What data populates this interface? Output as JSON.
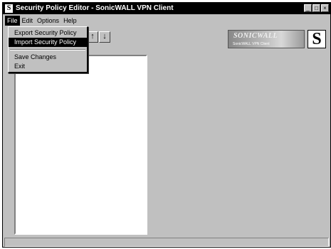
{
  "window": {
    "title": "Security Policy Editor - SonicWALL VPN Client",
    "app_icon_letter": "S",
    "controls": [
      "_",
      "□",
      "×"
    ]
  },
  "menubar": {
    "items": [
      {
        "label": "File",
        "active": true
      },
      {
        "label": "Edit",
        "active": false
      },
      {
        "label": "Options",
        "active": false
      },
      {
        "label": "Help",
        "active": false
      }
    ]
  },
  "file_menu": {
    "items": [
      {
        "label": "Export Security Policy",
        "highlighted": false
      },
      {
        "label": "Import Security Policy",
        "highlighted": true
      },
      {
        "label": "Save Changes",
        "highlighted": false
      },
      {
        "label": "Exit",
        "highlighted": false
      }
    ]
  },
  "toolbar": {
    "up_arrow": "↑",
    "down_arrow": "↓"
  },
  "branding": {
    "logo_text": "SONICWALL",
    "logo_subtitle": "SonicWALL VPN Client",
    "logo_mark": "S"
  },
  "icons": {
    "app": "sonicwall-s-icon",
    "move_up": "arrow-up-icon",
    "move_down": "arrow-down-icon",
    "tree_root": "network-icon"
  }
}
